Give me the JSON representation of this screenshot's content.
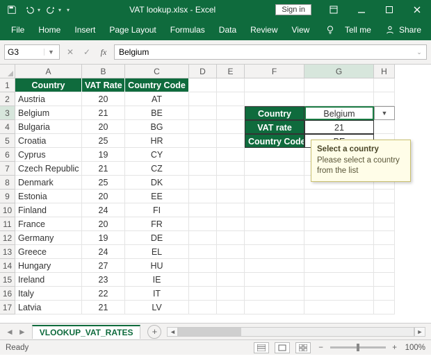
{
  "titlebar": {
    "title": "VAT lookup.xlsx - Excel",
    "signin": "Sign in"
  },
  "ribbon": {
    "tabs": [
      "File",
      "Home",
      "Insert",
      "Page Layout",
      "Formulas",
      "Data",
      "Review",
      "View"
    ],
    "tellme": "Tell me",
    "share": "Share"
  },
  "namebox": {
    "value": "G3"
  },
  "formula": {
    "value": "Belgium"
  },
  "columns": [
    "A",
    "B",
    "C",
    "D",
    "E",
    "F",
    "G",
    "H"
  ],
  "activeCol": "G",
  "activeRow": 3,
  "headerRow": {
    "a": "Country",
    "b": "VAT Rate",
    "c": "Country Code"
  },
  "rows": [
    {
      "n": 2,
      "a": "Austria",
      "b": 20,
      "c": "AT"
    },
    {
      "n": 3,
      "a": "Belgium",
      "b": 21,
      "c": "BE"
    },
    {
      "n": 4,
      "a": "Bulgaria",
      "b": 20,
      "c": "BG"
    },
    {
      "n": 5,
      "a": "Croatia",
      "b": 25,
      "c": "HR"
    },
    {
      "n": 6,
      "a": "Cyprus",
      "b": 19,
      "c": "CY"
    },
    {
      "n": 7,
      "a": "Czech Republic",
      "b": 21,
      "c": "CZ"
    },
    {
      "n": 8,
      "a": "Denmark",
      "b": 25,
      "c": "DK"
    },
    {
      "n": 9,
      "a": "Estonia",
      "b": 20,
      "c": "EE"
    },
    {
      "n": 10,
      "a": "Finland",
      "b": 24,
      "c": "FI"
    },
    {
      "n": 11,
      "a": "France",
      "b": 20,
      "c": "FR"
    },
    {
      "n": 12,
      "a": "Germany",
      "b": 19,
      "c": "DE"
    },
    {
      "n": 13,
      "a": "Greece",
      "b": 24,
      "c": "EL"
    },
    {
      "n": 14,
      "a": "Hungary",
      "b": 27,
      "c": "HU"
    },
    {
      "n": 15,
      "a": "Ireland",
      "b": 23,
      "c": "IE"
    },
    {
      "n": 16,
      "a": "Italy",
      "b": 22,
      "c": "IT"
    },
    {
      "n": 17,
      "a": "Latvia",
      "b": 21,
      "c": "LV"
    }
  ],
  "lookup": {
    "labels": {
      "country": "Country",
      "rate": "VAT rate",
      "code": "Country Code"
    },
    "values": {
      "country": "Belgium",
      "rate": 21,
      "code": "BE"
    }
  },
  "tooltip": {
    "title": "Select a country",
    "body": "Please select a country from the list"
  },
  "sheet": {
    "name": "VLOOKUP_VAT_RATES"
  },
  "status": {
    "ready": "Ready",
    "zoom": "100%"
  },
  "chart_data": {
    "type": "table",
    "columns": [
      "Country",
      "VAT Rate",
      "Country Code"
    ],
    "rows": [
      [
        "Austria",
        20,
        "AT"
      ],
      [
        "Belgium",
        21,
        "BE"
      ],
      [
        "Bulgaria",
        20,
        "BG"
      ],
      [
        "Croatia",
        25,
        "HR"
      ],
      [
        "Cyprus",
        19,
        "CY"
      ],
      [
        "Czech Republic",
        21,
        "CZ"
      ],
      [
        "Denmark",
        25,
        "DK"
      ],
      [
        "Estonia",
        20,
        "EE"
      ],
      [
        "Finland",
        24,
        "FI"
      ],
      [
        "France",
        20,
        "FR"
      ],
      [
        "Germany",
        19,
        "DE"
      ],
      [
        "Greece",
        24,
        "EL"
      ],
      [
        "Hungary",
        27,
        "HU"
      ],
      [
        "Ireland",
        23,
        "IE"
      ],
      [
        "Italy",
        22,
        "IT"
      ],
      [
        "Latvia",
        21,
        "LV"
      ]
    ],
    "lookup_result": {
      "Country": "Belgium",
      "VAT rate": 21,
      "Country Code": "BE"
    }
  }
}
